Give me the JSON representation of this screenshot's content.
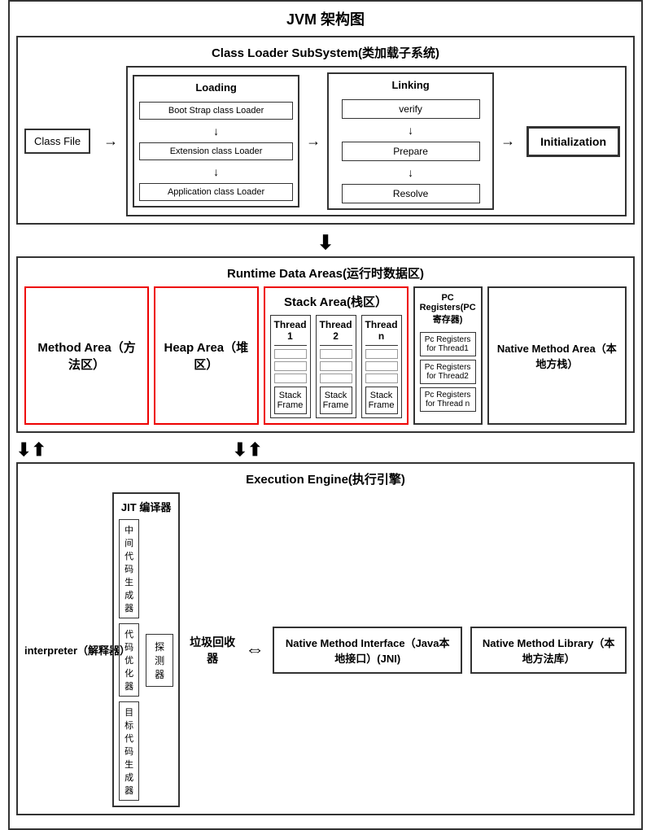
{
  "title": "JVM 架构图",
  "classloader": {
    "section_title": "Class Loader SubSystem(类加载子系统)",
    "classfile_label": "Class File",
    "loading_title": "Loading",
    "loaders": [
      "Boot Strap class Loader",
      "Extension class Loader",
      "Application class Loader"
    ],
    "linking_title": "Linking",
    "linking_items": [
      "verify",
      "Prepare",
      "Resolve"
    ],
    "init_label": "Initialization"
  },
  "runtime": {
    "section_title": "Runtime Data Areas(运行时数据区)",
    "method_area_label": "Method Area（方法区）",
    "heap_area_label": "Heap Area（堆区）",
    "stack_area": {
      "title": "Stack Area(栈区）",
      "threads": [
        {
          "label": "Thread 1",
          "frame": "Stack Frame"
        },
        {
          "label": "Thread 2",
          "frame": "Stack Frame"
        },
        {
          "label": "Thread n",
          "frame": "Stack Frame"
        }
      ]
    },
    "pc_registers": {
      "title": "PC Registers(PC寄存器)",
      "items": [
        "Pc Registers for Thread1",
        "Pc Registers for Thread2",
        "Pc Registers for Thread n"
      ]
    },
    "native_method_area": "Native Method Area（本地方栈）"
  },
  "execution": {
    "section_title": "Execution Engine(执行引擎)",
    "interpreter_label": "interpreter（解释器）",
    "jit": {
      "title": "JIT 编译器",
      "items": [
        "中间代码生成器",
        "代码优化器",
        "目标代码生成器"
      ],
      "explorer": "探测器"
    },
    "garbage_label": "垃圾回收器",
    "native_interface": "Native Method Interface（Java本地接口）(JNI)",
    "native_library": "Native Method Library（本地方法库）"
  }
}
